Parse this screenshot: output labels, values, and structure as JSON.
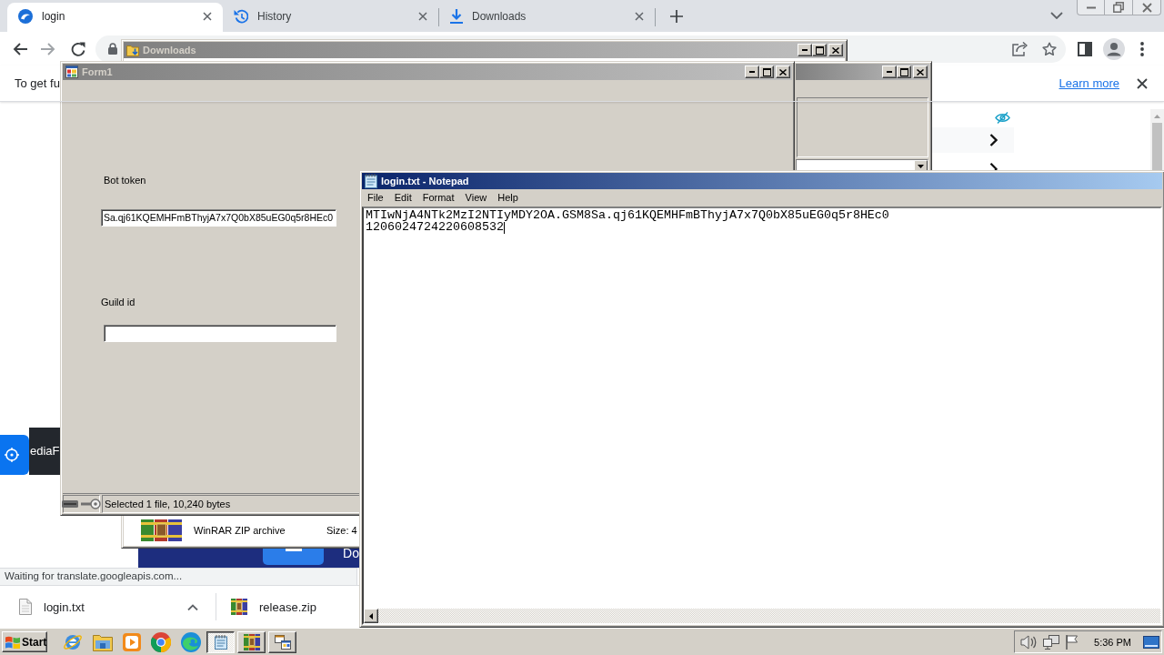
{
  "browser": {
    "tabs": [
      {
        "label": "login",
        "kind": "site",
        "selected": true
      },
      {
        "label": "History",
        "kind": "history",
        "selected": false
      },
      {
        "label": "Downloads",
        "kind": "downloads",
        "selected": false
      }
    ],
    "infobar": {
      "text": "To get fu",
      "link": "Learn more"
    },
    "page": {
      "widget_label": "ediaF",
      "banner_label": "Do"
    },
    "status_text": "Waiting for translate.googleapis.com...",
    "downloads": [
      {
        "name": "login.txt",
        "kind": "text"
      },
      {
        "name": "release.zip",
        "kind": "archive"
      }
    ]
  },
  "explorer_window": {
    "title": "Downloads",
    "active": false,
    "details": {
      "file_type": "WinRAR ZIP archive",
      "size": "Size: 4"
    }
  },
  "side_window": {
    "active": false
  },
  "form_window": {
    "title": "Form1",
    "active": false,
    "fields": [
      {
        "label": "Bot token",
        "value": "Sa.qj61KQEMHFmBThyjA7x7Q0bX85uEG0q5r8HEc0"
      },
      {
        "label": "Guild id"
      }
    ],
    "status_text": "Selected 1 file, 10,240 bytes"
  },
  "notepad_window": {
    "title": "login.txt - Notepad",
    "active": true,
    "menu": [
      "File",
      "Edit",
      "Format",
      "View",
      "Help"
    ],
    "lines": [
      "MTIwNjA4NTk2MzI2NTIyMDY2OA.GSM8Sa.qj61KQEMHFmBThyjA7x7Q0bX85uEG0q5r8HEc0",
      "1206024724220608532"
    ]
  },
  "taskbar": {
    "start_label": "Start",
    "tasks": [
      {
        "kind": "notepad",
        "selected": true
      },
      {
        "kind": "archive",
        "selected": false
      },
      {
        "kind": "app",
        "selected": false
      }
    ],
    "clock": "5:36 PM"
  }
}
